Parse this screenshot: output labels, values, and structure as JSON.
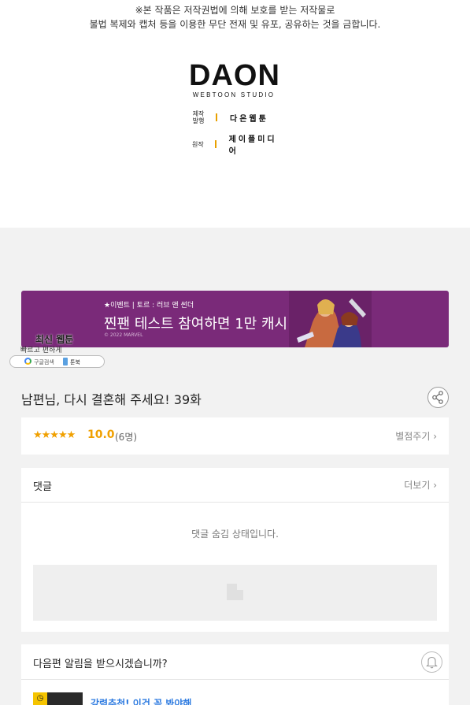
{
  "notice": {
    "line1": "※본 작품은 저작권법에 의해 보호를 받는 저작물로",
    "line2": "불법 복제와 캡처 등을 이용한 무단 전재 및 유포, 공유하는 것을 금합니다."
  },
  "studio_logo": {
    "name": "DAON",
    "subtitle": "WEBTOON STUDIO"
  },
  "credits": [
    {
      "role": "제작\n발행",
      "value": "다온웹툰"
    },
    {
      "role": "원작",
      "value": "제이플미디어"
    }
  ],
  "banner": {
    "small_text": "★이벤트 | 토르 : 러브 앤 썬더",
    "headline": "찐팬 테스트 참여하면 1만 캐시!",
    "copyright": "© 2022 MARVEL",
    "bg_color": "#7a2a79"
  },
  "overlay_ad": {
    "title": "최신 웹툰",
    "subtitle": "빠르고 편하게",
    "left_label": "구글검색",
    "right_label": "툰북"
  },
  "episode": {
    "title": "남편님, 다시 결혼해 주세요! 39화"
  },
  "rating": {
    "stars": "★★★★★",
    "score": "10.0",
    "count": "(6명)",
    "rate_link": "별점주기 ›",
    "accent": "#f0a000"
  },
  "comments": {
    "title": "댓글",
    "more": "더보기 ›",
    "hidden_message": "댓글 숨김 상태입니다."
  },
  "notify": {
    "question": "다음편 알림을 받으시겠습니까?",
    "next_link": "강력추천! 이건 꼭 봐야해"
  },
  "icons": {
    "share": "share-icon",
    "bell": "bell-icon",
    "clock": "clock-icon"
  }
}
